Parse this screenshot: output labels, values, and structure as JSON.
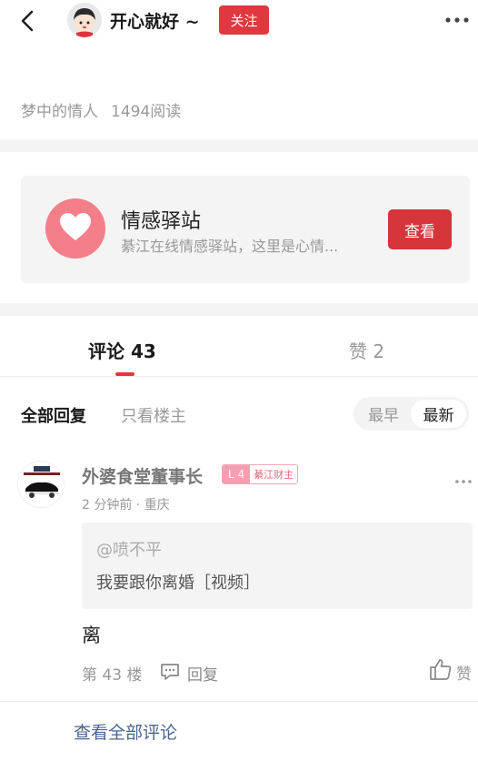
{
  "header": {
    "author_name": "开心就好 ~",
    "follow_label": "关注"
  },
  "post_meta": {
    "title": "梦中的情人",
    "read_count": "1494阅读"
  },
  "circle_card": {
    "title": "情感驿站",
    "description": "綦江在线情感驿站，这里是心情...",
    "button_label": "查看"
  },
  "tabs": [
    {
      "label": "评论 43",
      "active": true
    },
    {
      "label": "赞 2",
      "active": false
    }
  ],
  "filters": {
    "all_replies": "全部回复",
    "owner_only": "只看楼主",
    "sort_options": [
      "最早",
      "最新"
    ],
    "sort_selected": "最新"
  },
  "comment": {
    "username": "外婆食堂董事长",
    "level": "L 4",
    "level_title": "綦江财主",
    "meta": "2 分钟前 · 重庆",
    "quote_user": "@喷不平",
    "quote_text": "我要跟你离婚［视频］",
    "body": "离",
    "floor": "第 43 楼",
    "reply_label": "回复",
    "like_label": "赞"
  },
  "footer": {
    "view_all_label": "查看全部评论"
  },
  "colors": {
    "accent_red": "#e0383e",
    "link_blue": "#4a6491",
    "heart_pink": "#f47f8a"
  }
}
